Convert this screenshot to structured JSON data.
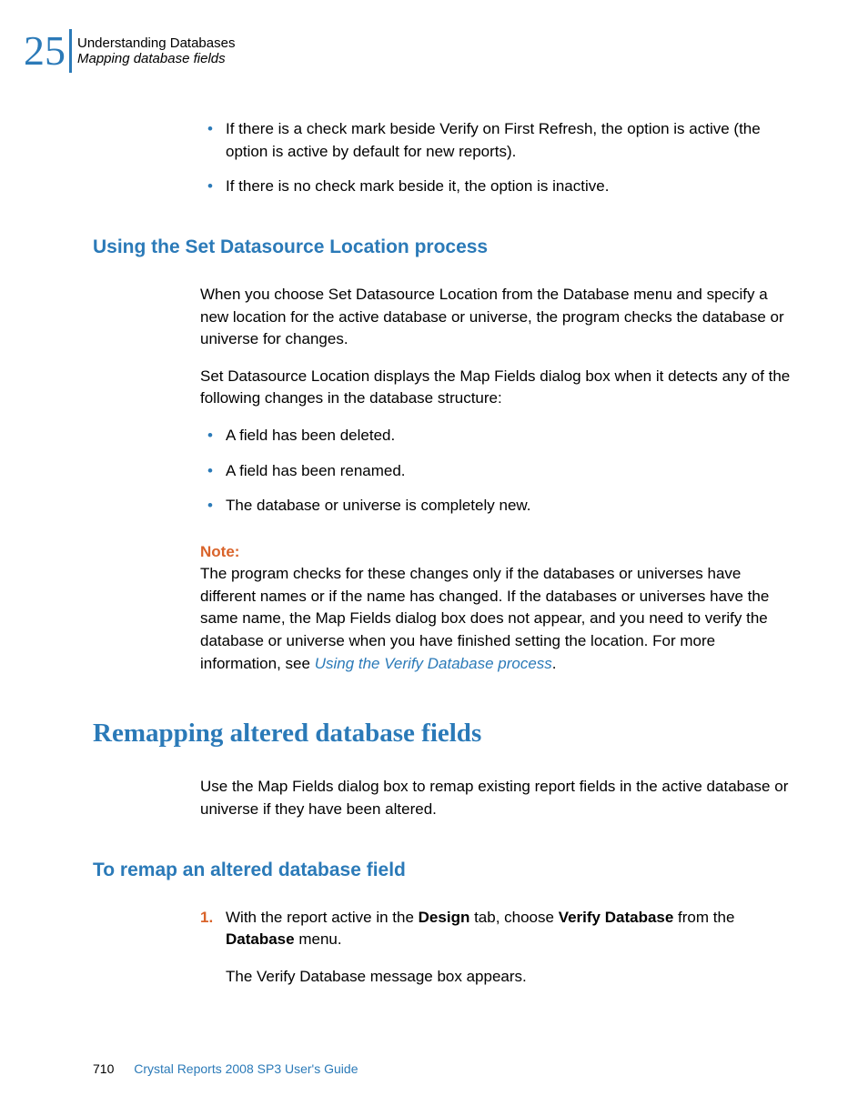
{
  "header": {
    "chapter_number": "25",
    "title": "Understanding Databases",
    "subtitle": "Mapping database fields"
  },
  "intro_bullets": [
    "If there is a check mark beside Verify on First Refresh, the option is active (the option is active by default for new reports).",
    "If there is no check mark beside it, the option is inactive."
  ],
  "section1": {
    "heading": "Using the Set Datasource Location process",
    "para1": "When you choose Set Datasource Location from the Database menu and specify a new location for the active database or universe, the program checks the database or universe for changes.",
    "para2": "Set Datasource Location displays the Map Fields dialog box when it detects any of the following changes in the database structure:",
    "bullets": [
      "A field has been deleted.",
      "A field has been renamed.",
      "The database or universe is completely new."
    ],
    "note_label": "Note:",
    "note_text_prefix": "The program checks for these changes only if the databases or universes have different names or if the name has changed. If the databases or universes have the same name, the Map Fields dialog box does not appear, and you need to verify the database or universe when you have finished setting the location. For more information, see ",
    "note_link": "Using the Verify Database process",
    "note_text_suffix": "."
  },
  "section2": {
    "heading": "Remapping altered database fields",
    "para1": "Use the Map Fields dialog box to remap existing report fields in the active database or universe if they have been altered."
  },
  "section3": {
    "heading": "To remap an altered database field",
    "step1_number": "1.",
    "step1_prefix": "With the report active in the ",
    "step1_bold1": "Design",
    "step1_mid1": " tab, choose ",
    "step1_bold2": "Verify Database",
    "step1_mid2": " from the ",
    "step1_bold3": "Database",
    "step1_suffix": " menu.",
    "step1_sub": "The Verify Database message box appears."
  },
  "footer": {
    "page_number": "710",
    "title": "Crystal Reports 2008 SP3 User's Guide"
  }
}
